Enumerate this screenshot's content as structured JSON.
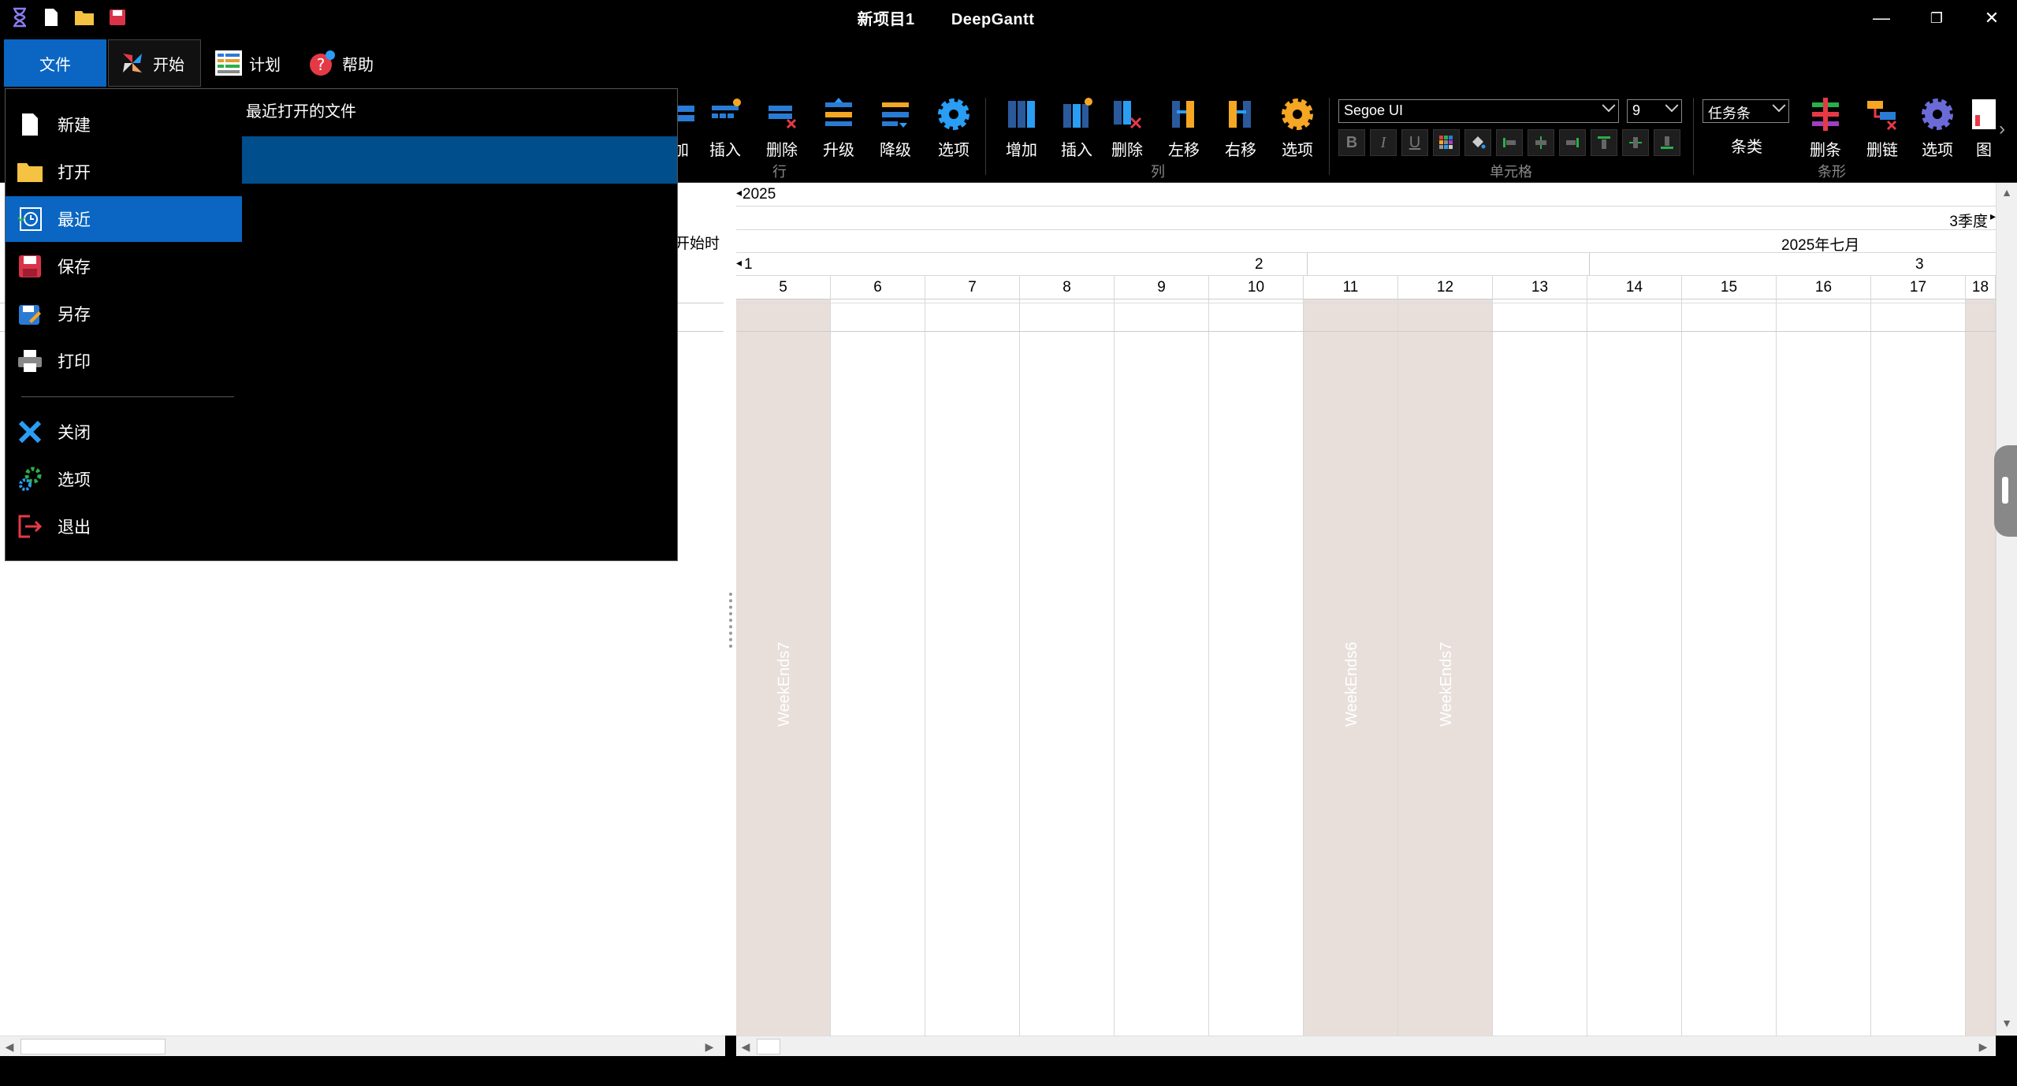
{
  "window": {
    "title": "新项目1",
    "app_name": "DeepGantt",
    "minimize": "—",
    "restore": "❐",
    "close": "✕"
  },
  "menu_tabs": [
    {
      "label": "文件"
    },
    {
      "label": "开始"
    },
    {
      "label": "计划"
    },
    {
      "label": "帮助"
    }
  ],
  "ribbon": {
    "row_group": {
      "label": "行",
      "buttons": [
        {
          "label": "加"
        },
        {
          "label": "插入"
        },
        {
          "label": "删除"
        },
        {
          "label": "升级"
        },
        {
          "label": "降级"
        },
        {
          "label": "选项"
        }
      ]
    },
    "col_group": {
      "label": "列",
      "buttons": [
        {
          "label": "增加"
        },
        {
          "label": "插入"
        },
        {
          "label": "删除"
        },
        {
          "label": "左移"
        },
        {
          "label": "右移"
        },
        {
          "label": "选项"
        }
      ]
    },
    "cell_group": {
      "label": "单元格",
      "font_family": "Segoe UI",
      "font_size": "9"
    },
    "bar_group": {
      "label": "条形",
      "bar_type": "任务条",
      "bar_type_caption": "条类",
      "buttons": [
        {
          "label": "删条"
        },
        {
          "label": "删链"
        },
        {
          "label": "选项"
        },
        {
          "label": "图"
        }
      ]
    }
  },
  "file_menu": {
    "items": [
      {
        "label": "新建",
        "icon": "new-doc-icon"
      },
      {
        "label": "打开",
        "icon": "folder-icon"
      },
      {
        "label": "最近",
        "icon": "recent-icon"
      },
      {
        "label": "保存",
        "icon": "save-icon"
      },
      {
        "label": "另存",
        "icon": "save-as-icon"
      },
      {
        "label": "打印",
        "icon": "print-icon"
      },
      {
        "label": "关闭",
        "icon": "close-x-icon"
      },
      {
        "label": "选项",
        "icon": "options-gears-icon"
      },
      {
        "label": "退出",
        "icon": "exit-icon"
      }
    ],
    "active_item": "最近",
    "recent_title": "最近打开的文件"
  },
  "grid": {
    "start_column_header": "开始时"
  },
  "timeline": {
    "year": "2025",
    "quarter": "3季度",
    "month": "2025年七月",
    "weeks": [
      "1",
      "2",
      "3"
    ],
    "days": [
      "5",
      "6",
      "7",
      "8",
      "9",
      "10",
      "11",
      "12",
      "13",
      "14",
      "15",
      "16",
      "17",
      "18"
    ],
    "weekend_labels": [
      "WeekEnds7",
      "WeekEnds6",
      "WeekEnds7"
    ],
    "weekend_color": "#e8dfdb"
  },
  "colors": {
    "accent": "#0a66c2",
    "selection": "#004e8c"
  }
}
